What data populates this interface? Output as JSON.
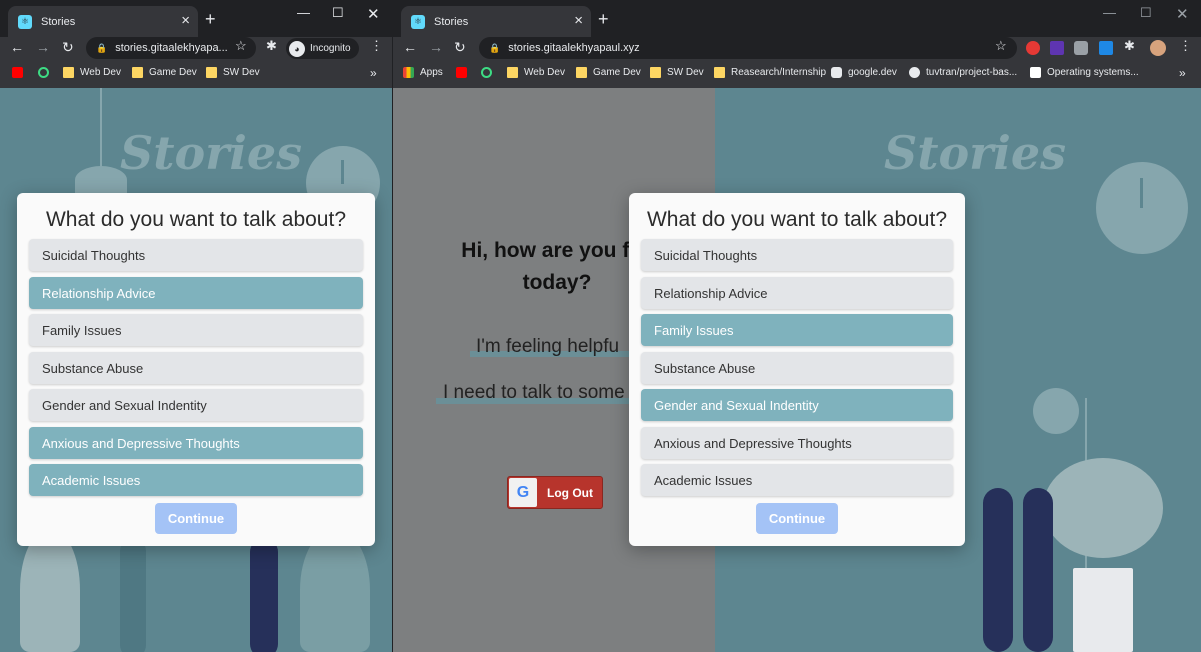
{
  "left_window": {
    "tab_title": "Stories",
    "url": "stories.gitaalekhyapa...",
    "profile_label": "Incognito",
    "bookmarks": [
      "Web Dev",
      "Game Dev",
      "SW Dev"
    ],
    "bookmarks_more": "»",
    "page": {
      "brand": "Stories",
      "modal": {
        "heading": "What do you want to talk about?",
        "options": [
          {
            "label": "Suicidal Thoughts",
            "selected": false
          },
          {
            "label": "Relationship Advice",
            "selected": true
          },
          {
            "label": "Family Issues",
            "selected": false
          },
          {
            "label": "Substance Abuse",
            "selected": false
          },
          {
            "label": "Gender and Sexual Indentity",
            "selected": false
          },
          {
            "label": "Anxious and Depressive Thoughts",
            "selected": true
          },
          {
            "label": "Academic Issues",
            "selected": true
          }
        ],
        "continue_label": "Continue"
      }
    }
  },
  "right_window": {
    "tab_title": "Stories",
    "url": "stories.gitaalekhyapaul.xyz",
    "bookmarks": [
      "Apps",
      "Web Dev",
      "Game Dev",
      "SW Dev",
      "Reasearch/Internship",
      "google.dev",
      "tuvtran/project-bas...",
      "Operating systems..."
    ],
    "bookmarks_more": "»",
    "page": {
      "brand": "Stories",
      "greeting": "Hi, how are you feeling today?",
      "greeting_line1": "Hi, how are you fee",
      "greeting_line2": "today?",
      "choice_helpful": "I'm feeling helpfu",
      "choice_talk": "I need to talk to some",
      "logout_label": "Log Out",
      "google_letter": "G",
      "modal": {
        "heading": "What do you want to talk about?",
        "options": [
          {
            "label": "Suicidal Thoughts",
            "selected": false
          },
          {
            "label": "Relationship Advice",
            "selected": false
          },
          {
            "label": "Family Issues",
            "selected": true
          },
          {
            "label": "Substance Abuse",
            "selected": false
          },
          {
            "label": "Gender and Sexual Indentity",
            "selected": true
          },
          {
            "label": "Anxious and Depressive Thoughts",
            "selected": false
          },
          {
            "label": "Academic Issues",
            "selected": false
          }
        ],
        "continue_label": "Continue"
      }
    }
  },
  "colors": {
    "selected_option": "#7fb2bd",
    "option_default": "#e3e5e8",
    "continue_button": "#a4c3f6",
    "background": "#5d8690"
  }
}
